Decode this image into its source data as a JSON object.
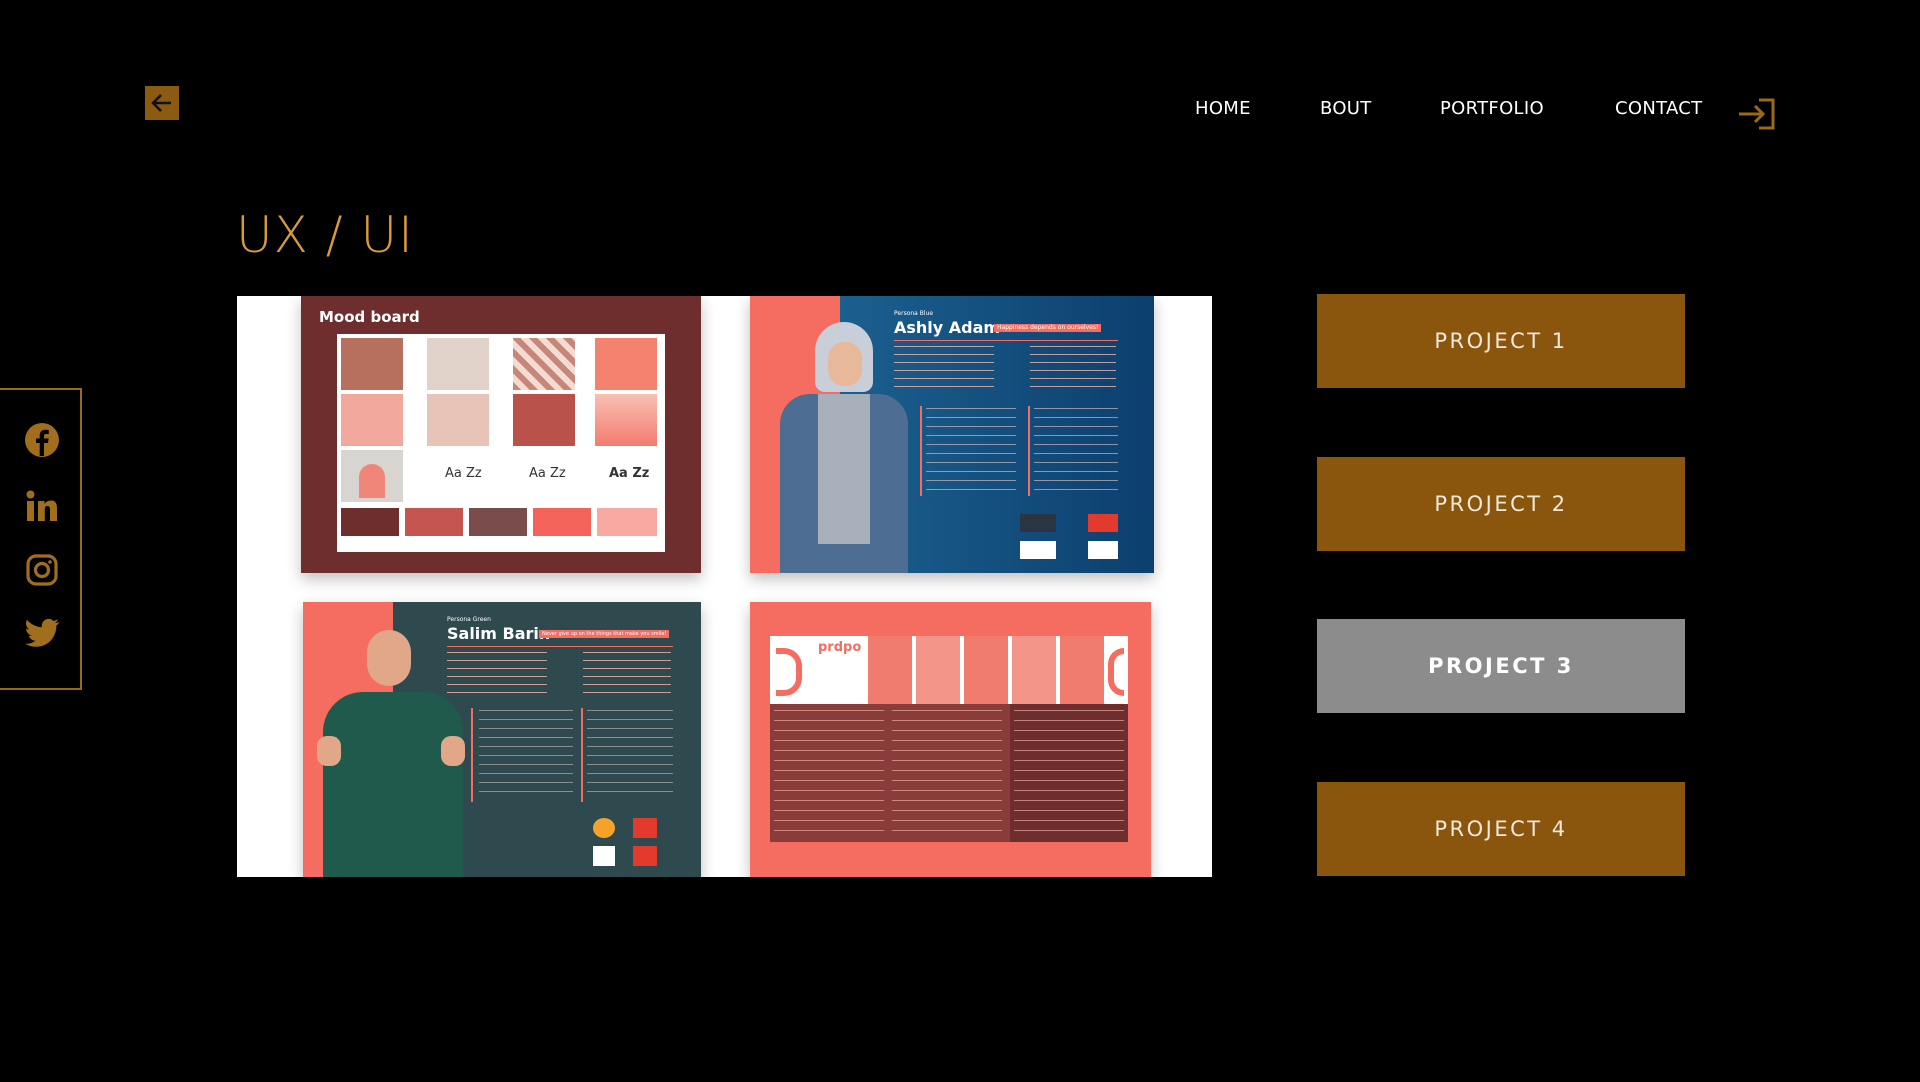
{
  "nav": {
    "items": [
      {
        "label": "HOME"
      },
      {
        "label": "BOUT"
      },
      {
        "label": "PORTFOLIO"
      },
      {
        "label": "CONTACT"
      }
    ]
  },
  "page": {
    "title": "UX / UI"
  },
  "gallery": {
    "moodboard": {
      "title": "Mood board",
      "type_samples": [
        "Aa Zz",
        "Aa Zz",
        "Aa Zz"
      ]
    },
    "persona_blue": {
      "tag": "Persona Blue",
      "name": "Ashly Adam",
      "quote": "Happiness depends on ourselves!"
    },
    "persona_green": {
      "tag": "Persona Green",
      "name": "Salim Barin",
      "quote": "Never give up on the things that make you smile!"
    },
    "brief": {
      "logo_text": "prdpo"
    }
  },
  "projects": [
    {
      "label": "PROJECT 1",
      "active": false
    },
    {
      "label": "PROJECT 2",
      "active": false
    },
    {
      "label": "PROJECT 3",
      "active": true
    },
    {
      "label": "PROJECT 4",
      "active": false
    }
  ],
  "colors": {
    "accent": "#d89a3a",
    "button": "#8a560d",
    "active": "#8c8c8c"
  },
  "icons": [
    "back-arrow-icon",
    "login-icon",
    "facebook-icon",
    "linkedin-icon",
    "instagram-icon",
    "twitter-icon"
  ]
}
